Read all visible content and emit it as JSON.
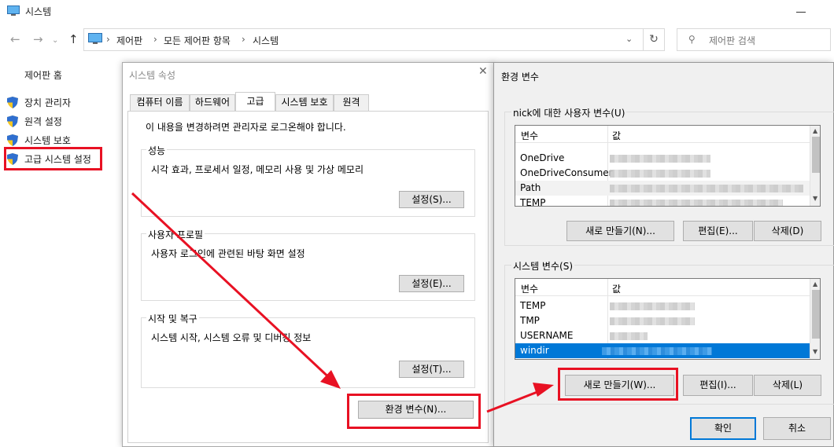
{
  "window": {
    "title": "시스템",
    "breadcrumb": [
      "제어판",
      "모든 제어판 항목",
      "시스템"
    ],
    "search_placeholder": "제어판 검색"
  },
  "sidebar": {
    "home": "제어판 홈",
    "items": [
      "장치 관리자",
      "원격 설정",
      "시스템 보호",
      "고급 시스템 설정"
    ]
  },
  "system_properties": {
    "title": "시스템 속성",
    "tabs": [
      "컴퓨터 이름",
      "하드웨어",
      "고급",
      "시스템 보호",
      "원격"
    ],
    "active_tab": "고급",
    "admin_note": "이 내용을 변경하려면 관리자로 로그온해야 합니다.",
    "groups": [
      {
        "title": "성능",
        "desc": "시각 효과, 프로세서 일정, 메모리 사용 및 가상 메모리",
        "button": "설정(S)..."
      },
      {
        "title": "사용자 프로필",
        "desc": "사용자 로그인에 관련된 바탕 화면 설정",
        "button": "설정(E)..."
      },
      {
        "title": "시작 및 복구",
        "desc": "시스템 시작, 시스템 오류 및 디버깅 정보",
        "button": "설정(T)..."
      }
    ],
    "env_button": "환경 변수(N)..."
  },
  "env_vars": {
    "title": "환경 변수",
    "user_group_title": "nick에 대한 사용자 변수(U)",
    "col_var": "변수",
    "col_val": "값",
    "user_vars": [
      "OneDrive",
      "OneDriveConsumer",
      "Path",
      "TEMP"
    ],
    "user_buttons": [
      "새로 만들기(N)...",
      "편집(E)...",
      "삭제(D)"
    ],
    "system_group_title": "시스템 변수(S)",
    "system_vars": [
      "TEMP",
      "TMP",
      "USERNAME",
      "windir"
    ],
    "selected_system_var": "windir",
    "system_buttons": [
      "새로 만들기(W)...",
      "편집(I)...",
      "삭제(L)"
    ],
    "ok": "확인",
    "cancel": "취소"
  },
  "colors": {
    "annotation_red": "#e81123",
    "selection_blue": "#0078d7"
  }
}
